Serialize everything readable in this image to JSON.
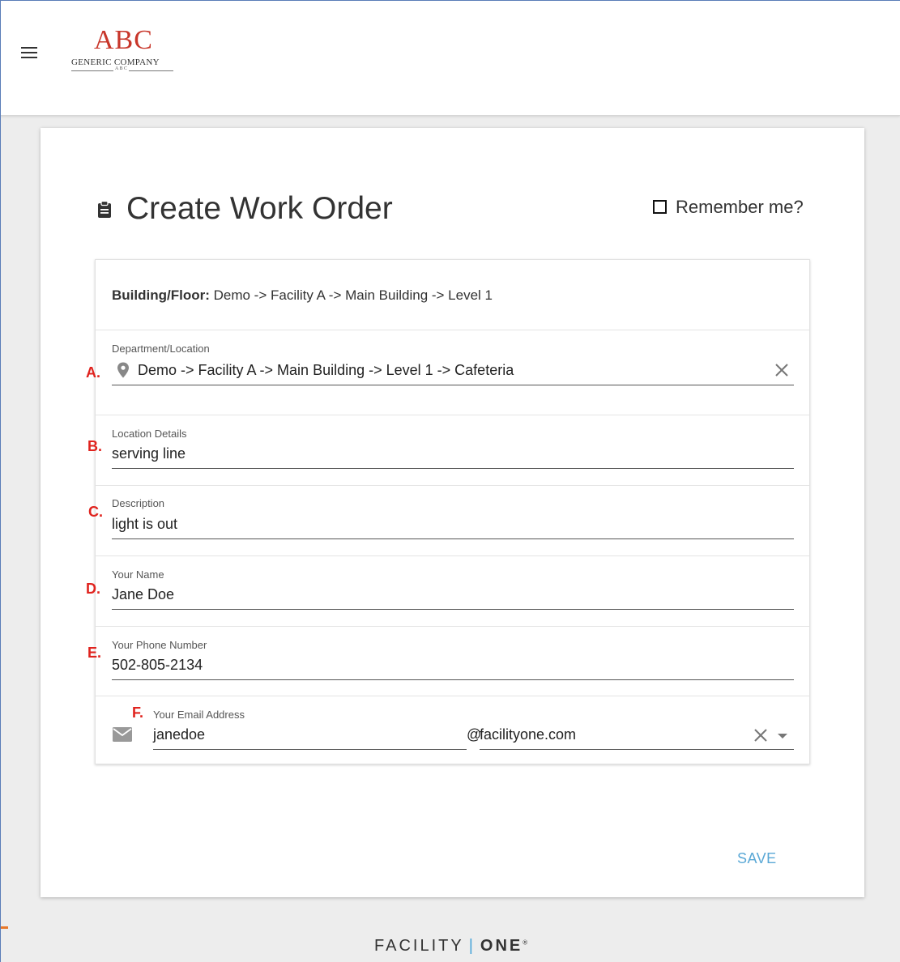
{
  "header": {
    "logo_main": "ABC",
    "logo_sub": "GENERIC COMPANY",
    "logo_small": "A B C"
  },
  "page": {
    "title": "Create Work Order",
    "remember_label": "Remember me?",
    "save_label": "SAVE"
  },
  "form": {
    "building_label": "Building/Floor:",
    "building_value": "Demo -> Facility A -> Main Building -> Level 1",
    "fields": [
      {
        "marker": "A.",
        "label": "Department/Location",
        "value": "Demo -> Facility A -> Main Building -> Level 1 -> Cafeteria"
      },
      {
        "marker": "B.",
        "label": "Location Details",
        "value": "serving line"
      },
      {
        "marker": "C.",
        "label": "Description",
        "value": "light is out"
      },
      {
        "marker": "D.",
        "label": "Your Name",
        "value": "Jane Doe"
      },
      {
        "marker": "E.",
        "label": "Your Phone Number",
        "value": "502-805-2134"
      }
    ],
    "email": {
      "marker": "F.",
      "label": "Your Email Address",
      "user": "janedoe",
      "at": "@",
      "domain": "facilityone.com"
    }
  },
  "footer": {
    "brand_left": "FACILITY",
    "brand_sep": "|",
    "brand_right": "ONE",
    "brand_mark": "®"
  },
  "colors": {
    "accent": "#5aa8d6",
    "marker": "#e0231e",
    "logo": "#c8372b",
    "footer_mark": "#e8792b"
  }
}
